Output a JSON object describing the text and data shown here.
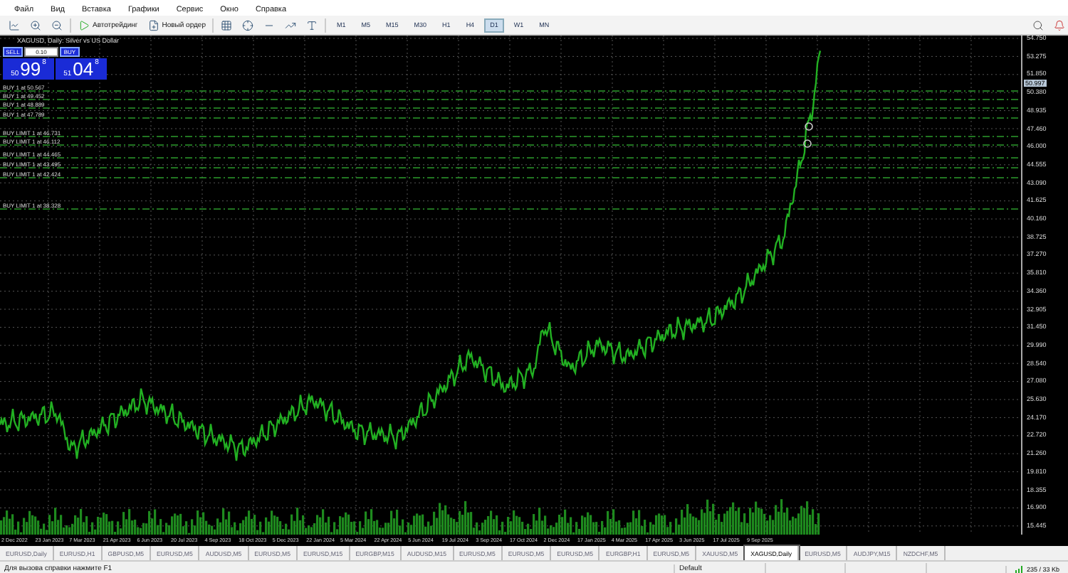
{
  "menu": [
    "Файл",
    "Вид",
    "Вставка",
    "Графики",
    "Сервис",
    "Окно",
    "Справка"
  ],
  "toolbar": {
    "autotrading": "Автотрейдинг",
    "new_order": "Новый ордер"
  },
  "timeframes": [
    {
      "label": "M1",
      "selected": false
    },
    {
      "label": "M5",
      "selected": false
    },
    {
      "label": "M15",
      "selected": false
    },
    {
      "label": "M30",
      "selected": false
    },
    {
      "label": "H1",
      "selected": false
    },
    {
      "label": "H4",
      "selected": false
    },
    {
      "label": "D1",
      "selected": true
    },
    {
      "label": "W1",
      "selected": false
    },
    {
      "label": "MN",
      "selected": false
    }
  ],
  "chart": {
    "title": "XAGUSD, Daily: Silver vs US Dollar",
    "one_click": {
      "sell": "SELL",
      "buy": "BUY",
      "lot": "0.10",
      "sell_price": [
        "50",
        "99",
        "8"
      ],
      "buy_price": [
        "51",
        "04",
        "8"
      ]
    },
    "orders": [
      {
        "label": "BUY 1 at 50.567"
      },
      {
        "label": "BUY 1 at 49.452"
      },
      {
        "label": "BUY 1 at 48.889"
      },
      {
        "label": "BUY 1 at 47.789"
      },
      {
        "label": "BUY LIMIT 1 at 46.731"
      },
      {
        "label": "BUY LIMIT 1 at 46.112"
      },
      {
        "label": "BUY LIMIT 1 at 44.465"
      },
      {
        "label": "BUY LIMIT 1 at 43.495"
      },
      {
        "label": "BUY LIMIT 1 at 42.424"
      },
      {
        "label": "BUY LIMIT 1 at 38.328"
      }
    ],
    "price_axis": [
      "54.750",
      "53.275",
      "51.850",
      "50.380",
      "48.935",
      "47.460",
      "46.000",
      "44.555",
      "43.090",
      "41.625",
      "40.160",
      "38.725",
      "37.270",
      "35.810",
      "34.360",
      "32.905",
      "31.450",
      "29.990",
      "28.540",
      "27.080",
      "25.630",
      "24.170",
      "22.720",
      "21.260",
      "19.810",
      "18.355",
      "16.900",
      "15.445"
    ],
    "current_price": "50.997",
    "date_axis": [
      "2 Dec 2022",
      "23 Jan 2023",
      "7 Mar 2023",
      "21 Apr 2023",
      "6 Jun 2023",
      "20 Jul 2023",
      "4 Sep 2023",
      "18 Oct 2023",
      "5 Dec 2023",
      "22 Jan 2024",
      "5 Mar 2024",
      "22 Apr 2024",
      "5 Jun 2024",
      "19 Jul 2024",
      "3 Sep 2024",
      "17 Oct 2024",
      "2 Dec 2024",
      "17 Jan 2025",
      "4 Mar 2025",
      "17 Apr 2025",
      "3 Jun 2025",
      "17 Jul 2025",
      "9 Sep 2025"
    ]
  },
  "tabs": [
    {
      "label": "EURUSD,Daily",
      "selected": false
    },
    {
      "label": "EURUSD,H1",
      "selected": false
    },
    {
      "label": "GBPUSD,M5",
      "selected": false
    },
    {
      "label": "EURUSD,M5",
      "selected": false
    },
    {
      "label": "AUDUSD,M5",
      "selected": false
    },
    {
      "label": "EURUSD,M5",
      "selected": false
    },
    {
      "label": "EURUSD,M15",
      "selected": false
    },
    {
      "label": "EURGBP,M15",
      "selected": false
    },
    {
      "label": "AUDUSD,M15",
      "selected": false
    },
    {
      "label": "EURUSD,M5",
      "selected": false
    },
    {
      "label": "EURUSD,M5",
      "selected": false
    },
    {
      "label": "EURUSD,M5",
      "selected": false
    },
    {
      "label": "EURGBP,H1",
      "selected": false
    },
    {
      "label": "EURUSD,M5",
      "selected": false
    },
    {
      "label": "XAUUSD,M5",
      "selected": false
    },
    {
      "label": "XAGUSD,Daily",
      "selected": true
    },
    {
      "label": "EURUSD,M5",
      "selected": false
    },
    {
      "label": "AUDJPY,M15",
      "selected": false
    },
    {
      "label": "NZDCHF,M5",
      "selected": false
    }
  ],
  "status_bar": {
    "help": "Для вызова справки нажмите F1",
    "profile": "Default",
    "traffic": "235 / 33 Kb"
  }
}
